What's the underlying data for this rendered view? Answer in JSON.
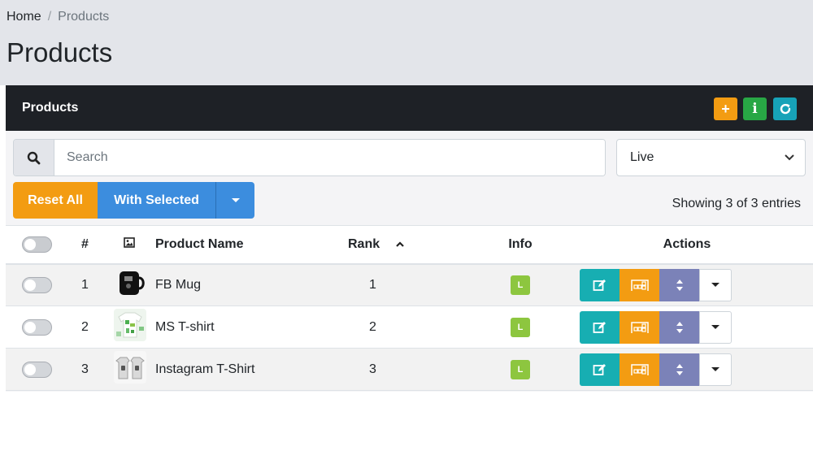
{
  "breadcrumb": {
    "home": "Home",
    "separator": "/",
    "current": "Products"
  },
  "page_title": "Products",
  "card": {
    "title": "Products",
    "header_buttons": [
      {
        "name": "add-icon",
        "glyph": "+"
      },
      {
        "name": "info-icon",
        "glyph": "i"
      },
      {
        "name": "refresh-icon",
        "glyph": ""
      }
    ]
  },
  "search": {
    "placeholder": "Search",
    "value": ""
  },
  "status_filter": {
    "selected": "Live"
  },
  "buttons": {
    "reset_all": "Reset All",
    "with_selected": "With Selected"
  },
  "entries_info": "Showing 3 of 3 entries",
  "table": {
    "columns": {
      "number": "#",
      "product_name": "Product Name",
      "rank": "Rank",
      "info": "Info",
      "actions": "Actions"
    },
    "rows": [
      {
        "number": "1",
        "name": "FB Mug",
        "rank": "1",
        "info_badge": "L",
        "thumbnail": "black-mug-thumbnail"
      },
      {
        "number": "2",
        "name": "MS T-shirt",
        "rank": "2",
        "info_badge": "L",
        "thumbnail": "green-tshirt-thumbnail"
      },
      {
        "number": "3",
        "name": "Instagram T-Shirt",
        "rank": "3",
        "info_badge": "L",
        "thumbnail": "grey-tshirt-thumbnail"
      }
    ]
  },
  "colors": {
    "header_bg": "#1e2126",
    "orange": "#f39c12",
    "green": "#28a745",
    "teal": "#17a2b8",
    "blue": "#3c8dde",
    "purple": "#7b82b8",
    "badge": "#8dc63f"
  }
}
